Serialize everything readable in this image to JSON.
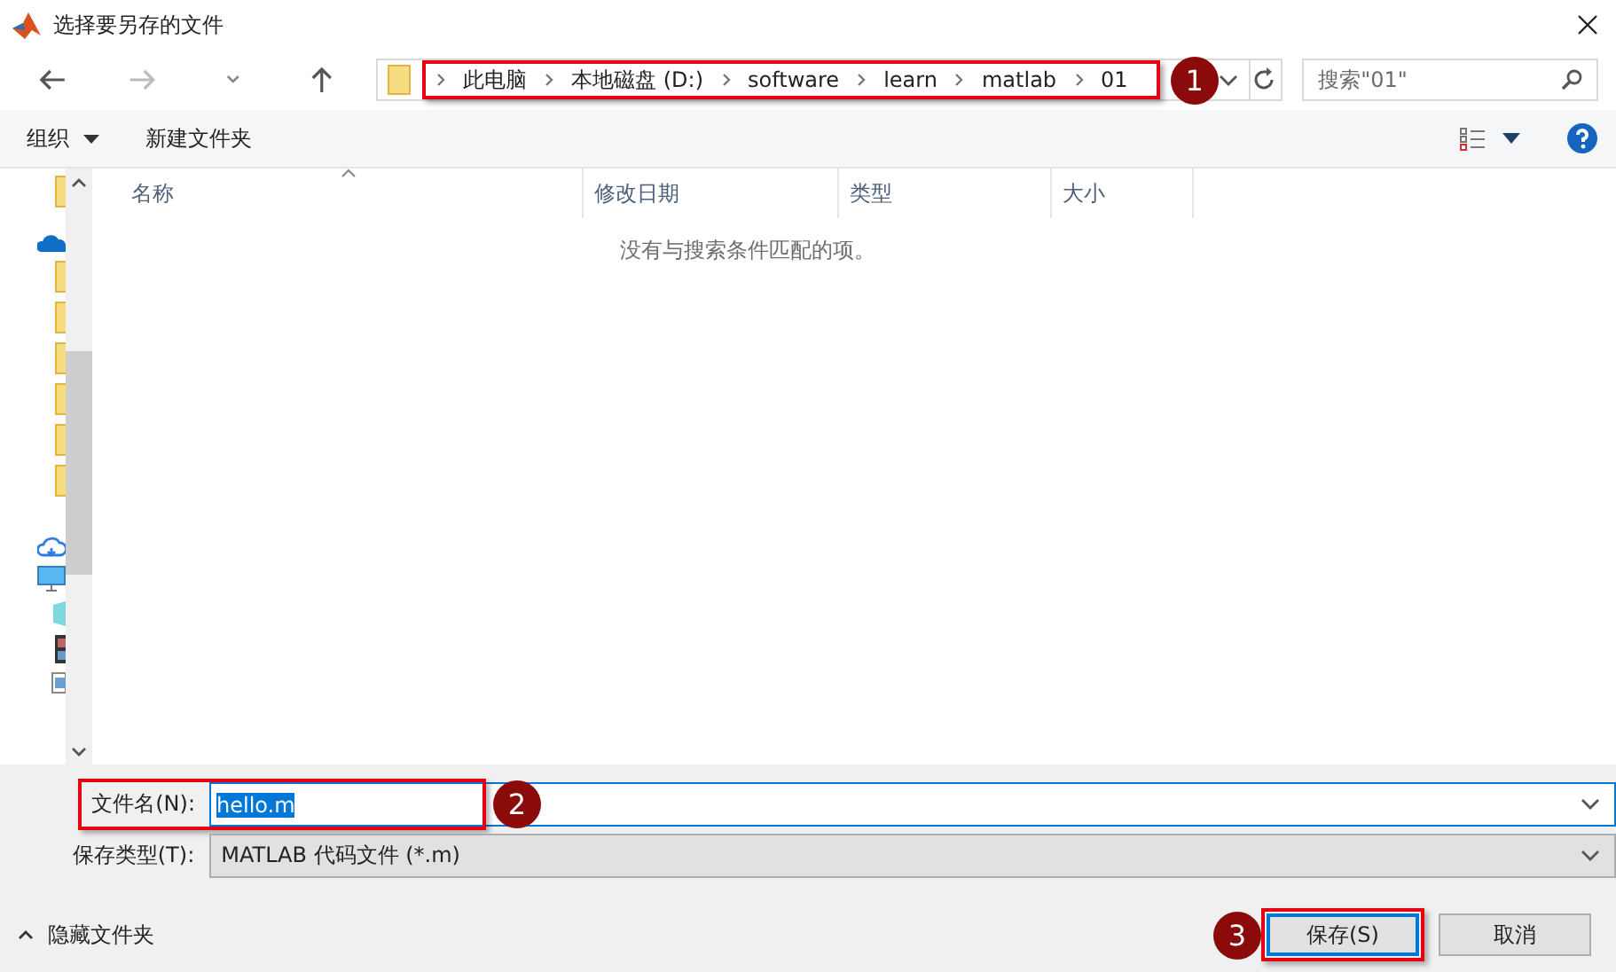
{
  "window": {
    "title": "选择要另存的文件"
  },
  "address_bar": {
    "path": [
      "此电脑",
      "本地磁盘 (D:)",
      "software",
      "learn",
      "matlab",
      "01"
    ],
    "highlighted": true
  },
  "search": {
    "placeholder": "搜索\"01\""
  },
  "toolbar": {
    "organize": "组织",
    "new_folder": "新建文件夹"
  },
  "columns": [
    {
      "label": "名称",
      "sorted": true
    },
    {
      "label": "修改日期",
      "sorted": false
    },
    {
      "label": "类型",
      "sorted": false
    },
    {
      "label": "大小",
      "sorted": false
    }
  ],
  "empty_message": "没有与搜索条件匹配的项。",
  "file_name": {
    "label": "文件名(N):",
    "value": "hello.m",
    "value_selected": true,
    "highlighted": true
  },
  "save_type": {
    "label": "保存类型(T):",
    "value": "MATLAB 代码文件 (*.m)"
  },
  "hide_folders": "隐藏文件夹",
  "buttons": [
    {
      "label": "保存(S)",
      "default": true,
      "highlighted": true
    },
    {
      "label": "取消",
      "default": false,
      "highlighted": false
    }
  ],
  "callouts": [
    {
      "number": "1"
    },
    {
      "number": "2"
    },
    {
      "number": "3"
    }
  ]
}
